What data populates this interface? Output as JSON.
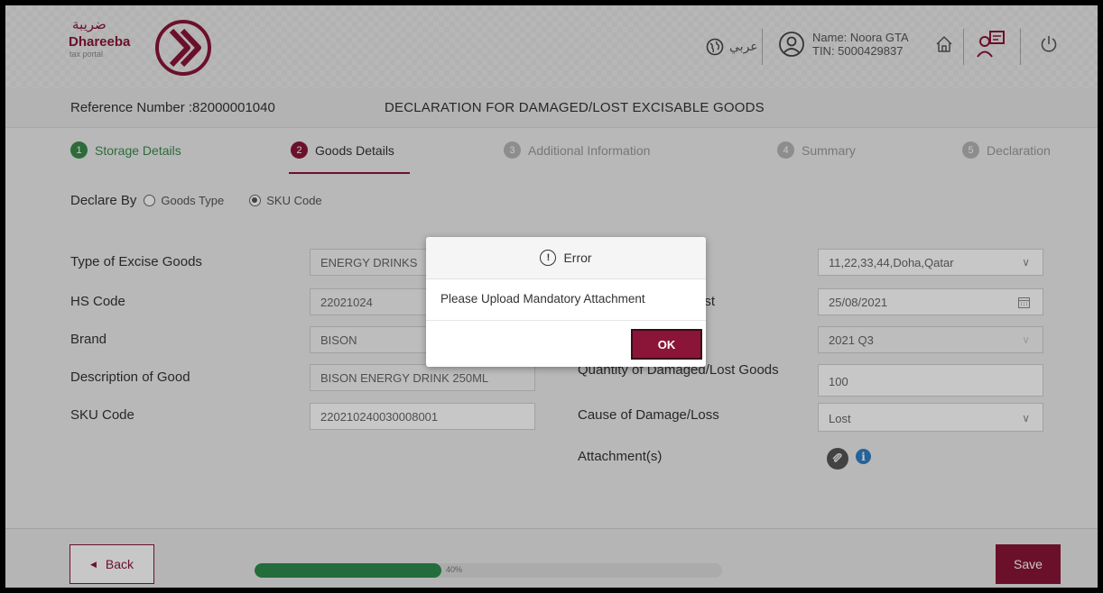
{
  "header": {
    "logo_ar": "ضريبة",
    "logo_en": "Dhareeba",
    "logo_sub": "tax portal",
    "language_label": "عربي",
    "user_name": "Name: Noora GTA",
    "user_tin": "TIN: 5000429837",
    "icons": [
      "globe-icon",
      "user-icon",
      "home-icon",
      "approvals-icon",
      "power-icon"
    ]
  },
  "reference": {
    "number_label": "Reference Number :82000001040",
    "title": "DECLARATION FOR DAMAGED/LOST EXCISABLE GOODS"
  },
  "steps": [
    {
      "num": "1",
      "label": "Storage Details",
      "state": "done"
    },
    {
      "num": "2",
      "label": "Goods Details",
      "state": "active"
    },
    {
      "num": "3",
      "label": "Additional Information",
      "state": "pending"
    },
    {
      "num": "4",
      "label": "Summary",
      "state": "pending"
    },
    {
      "num": "5",
      "label": "Declaration",
      "state": "pending"
    }
  ],
  "declare_by": {
    "label": "Declare By",
    "options": [
      {
        "label": "Goods Type",
        "selected": false
      },
      {
        "label": "SKU Code",
        "selected": true
      }
    ]
  },
  "form_left": [
    {
      "label": "Type of Excise Goods",
      "value": "ENERGY DRINKS"
    },
    {
      "label": "HS Code",
      "value": "22021024"
    },
    {
      "label": "Brand",
      "value": "BISON"
    },
    {
      "label": "Description of Good",
      "value": "BISON ENERGY DRINK 250ML"
    },
    {
      "label": "SKU Code",
      "value": "220210240030008001"
    }
  ],
  "form_right": {
    "address_value": "11,22,33,44,Doha,Qatar",
    "date_label_partial": "ost",
    "date_value": "25/08/2021",
    "period_value": "2021 Q3",
    "quantity_label": "Quantity of Damaged/Lost Goods",
    "quantity_value": "100",
    "cause_label": "Cause of Damage/Loss",
    "cause_value": "Lost",
    "attachments_label": "Attachment(s)"
  },
  "modal": {
    "title": "Error",
    "message": "Please Upload Mandatory Attachment",
    "ok_label": "OK"
  },
  "footer": {
    "back_label": "Back",
    "progress_percent": 40,
    "progress_text": "40%",
    "save_label": "Save"
  },
  "colors": {
    "brand": "#8a1538",
    "success": "#3a8a4c",
    "info": "#2f80c4"
  }
}
